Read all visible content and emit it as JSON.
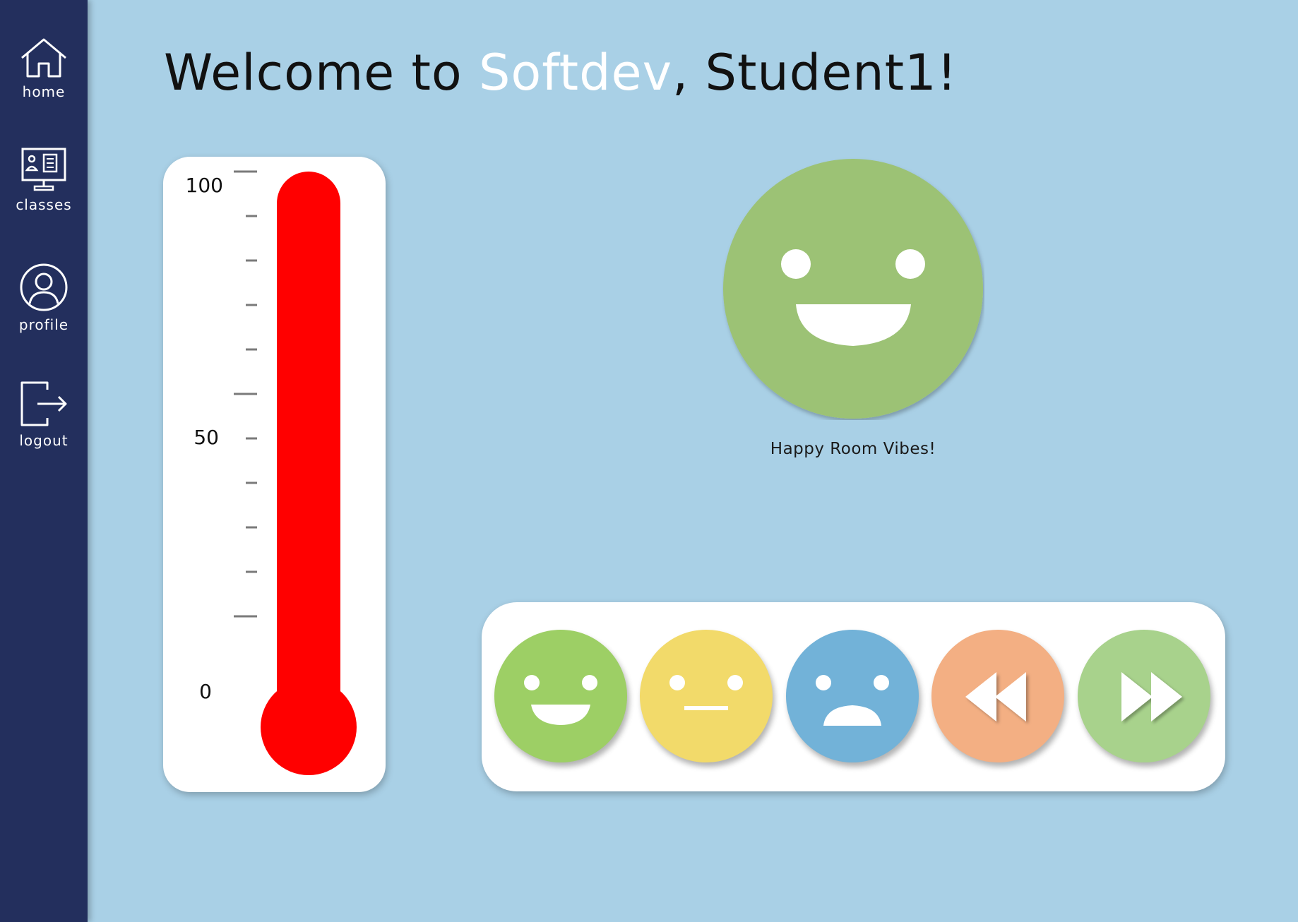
{
  "sidebar": {
    "items": [
      {
        "label": "home",
        "icon": "house-icon"
      },
      {
        "label": "classes",
        "icon": "classroom-icon"
      },
      {
        "label": "profile",
        "icon": "user-circle-icon"
      },
      {
        "label": "logout",
        "icon": "logout-icon"
      }
    ]
  },
  "header": {
    "prefix": "Welcome to ",
    "app_name": "Softdev",
    "suffix": ", Student1!"
  },
  "thermometer": {
    "labels": {
      "max": "100",
      "mid": "50",
      "min": "0"
    },
    "level_percent": 100,
    "fill_color": "#ff0000"
  },
  "mood": {
    "caption": "Happy Room Vibes!",
    "face": "happy-face-icon",
    "color": "#9cc274"
  },
  "buttons": [
    {
      "name": "happy-button",
      "icon": "happy-face-icon",
      "color": "#9dcf65"
    },
    {
      "name": "neutral-button",
      "icon": "neutral-face-icon",
      "color": "#f2da6a"
    },
    {
      "name": "sad-button",
      "icon": "sad-face-icon",
      "color": "#72b2d8"
    },
    {
      "name": "rewind-button",
      "icon": "rewind-icon",
      "color": "#f3af83"
    },
    {
      "name": "fast-forward-button",
      "icon": "fast-forward-icon",
      "color": "#a8d28c"
    }
  ],
  "colors": {
    "background": "#a9d0e6",
    "sidebar": "#232f5d",
    "accent": "#ffffff"
  }
}
